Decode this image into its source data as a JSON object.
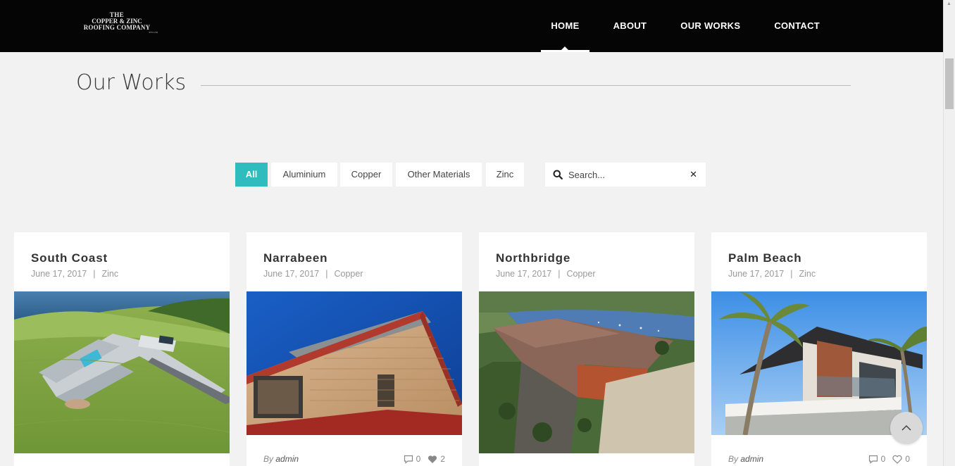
{
  "brand": {
    "logo_line1": "THE",
    "logo_line2": "COPPER & ZINC",
    "logo_line3": "ROOFING COMPANY",
    "logo_line4": "PTY LTD"
  },
  "nav": {
    "items": [
      {
        "label": "HOME",
        "active": true
      },
      {
        "label": "ABOUT",
        "active": false
      },
      {
        "label": "OUR WORKS",
        "active": false
      },
      {
        "label": "CONTACT",
        "active": false
      }
    ]
  },
  "page": {
    "title": "Our Works"
  },
  "filters": {
    "items": [
      "All",
      "Aluminium",
      "Copper",
      "Other Materials",
      "Zinc"
    ],
    "active": "All",
    "accent_color": "#2fbcbe"
  },
  "search": {
    "placeholder": "Search...",
    "value": ""
  },
  "cards": [
    {
      "title": "South Coast",
      "date": "June 17, 2017",
      "category": "Zinc"
    },
    {
      "title": "Narrabeen",
      "date": "June 17, 2017",
      "category": "Copper",
      "by": "By",
      "author": "admin",
      "comments": "0",
      "likes": "2"
    },
    {
      "title": "Northbridge",
      "date": "June 17, 2017",
      "category": "Copper"
    },
    {
      "title": "Palm Beach",
      "date": "June 17, 2017",
      "category": "Zinc",
      "by": "By",
      "author": "admin",
      "comments": "0",
      "likes": "0"
    }
  ],
  "icons": {
    "search": "search-icon",
    "clear": "close-icon",
    "comment": "comment-icon",
    "like": "heart-icon",
    "back_to_top": "chevron-up-icon"
  }
}
